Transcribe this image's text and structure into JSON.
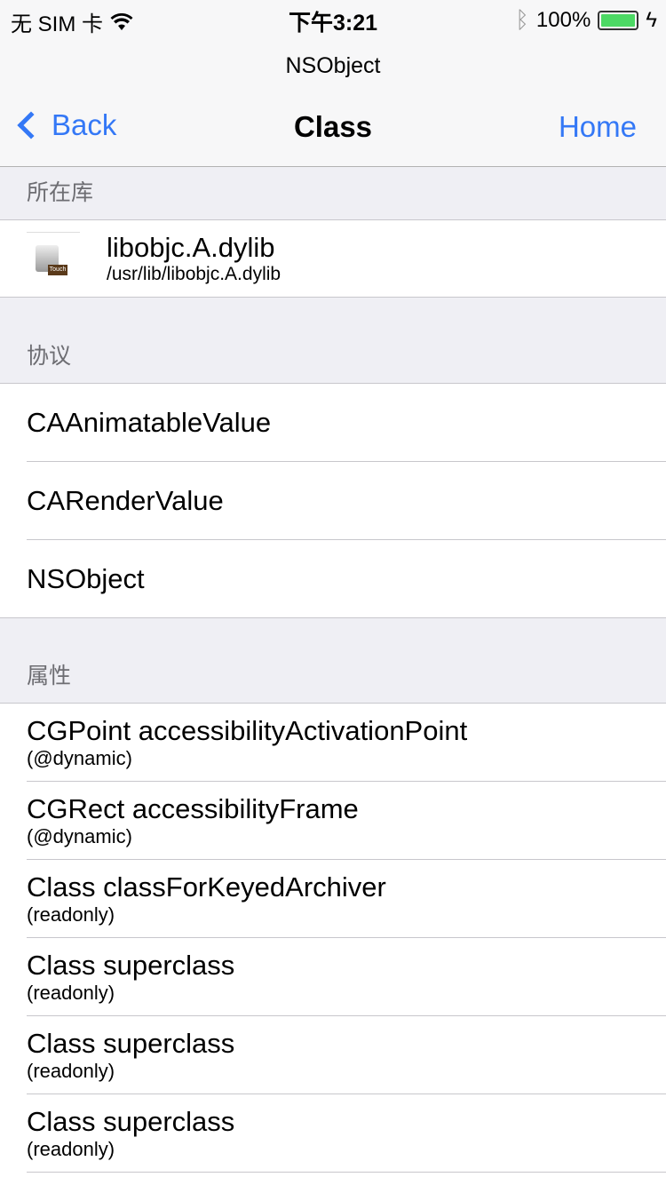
{
  "status": {
    "carrier": "无 SIM 卡",
    "time": "下午3:21",
    "battery": "100%"
  },
  "nav": {
    "prompt": "NSObject",
    "back": "Back",
    "title": "Class",
    "home": "Home"
  },
  "sections": {
    "library": {
      "header": "所在库",
      "name": "libobjc.A.dylib",
      "path": "/usr/lib/libobjc.A.dylib",
      "icon_label": "Touch"
    },
    "protocols": {
      "header": "协议",
      "items": [
        "CAAnimatableValue",
        "CARenderValue",
        "NSObject"
      ]
    },
    "properties": {
      "header": "属性",
      "items": [
        {
          "name": "CGPoint accessibilityActivationPoint",
          "attr": "(@dynamic)"
        },
        {
          "name": "CGRect accessibilityFrame",
          "attr": "(@dynamic)"
        },
        {
          "name": "Class classForKeyedArchiver",
          "attr": "(readonly)"
        },
        {
          "name": "Class superclass",
          "attr": "(readonly)"
        },
        {
          "name": "Class superclass",
          "attr": "(readonly)"
        },
        {
          "name": "Class superclass",
          "attr": "(readonly)"
        }
      ]
    }
  }
}
